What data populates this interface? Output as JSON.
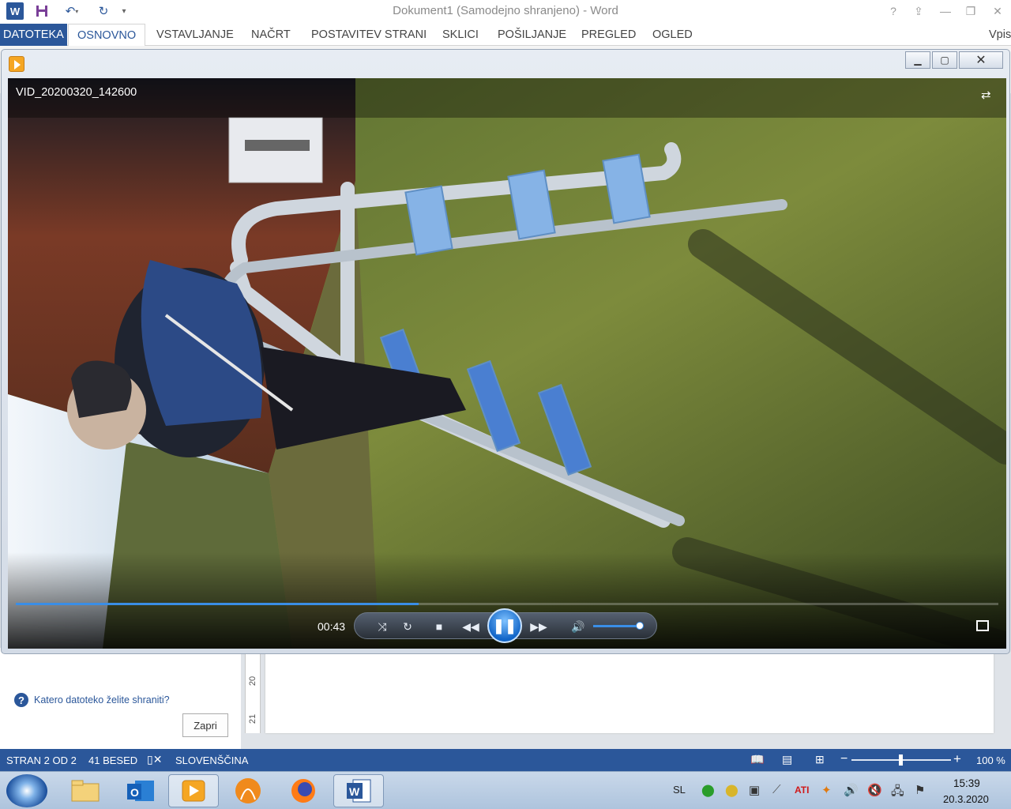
{
  "word": {
    "title": "Dokument1 (Samodejno shranjeno) - Word",
    "app_icon": "W",
    "window_controls": [
      "?",
      "⇪",
      "—",
      "❐",
      "✕"
    ],
    "tabs": [
      "DATOTEKA",
      "OSNOVNO",
      "VSTAVLJANJE",
      "NAČRT",
      "POSTAVITEV STRANI",
      "SKLICI",
      "POŠILJANJE",
      "PREGLED",
      "OGLED"
    ],
    "user_name": "Vpis",
    "active_tab": "OSNOVNO"
  },
  "player": {
    "video_title": "VID_20200320_142600",
    "time": "00:43",
    "progress": 0.41,
    "volume": 0.85,
    "icons": [
      "switch-view-icon",
      "fullscreen-icon",
      "shuffle-icon",
      "repeat-icon",
      "stop-icon",
      "previous-icon",
      "pause-icon",
      "next-icon",
      "volume-icon"
    ]
  },
  "side_pane": {
    "question": "Katero datoteko želite shraniti?",
    "close_label": "Zapri"
  },
  "ruler": {
    "n20": "20",
    "n21": "21"
  },
  "status": {
    "page": "STRAN 2 OD 2",
    "words": "41 BESED",
    "language": "SLOVENŠČINA",
    "zoom": "100 %",
    "zoom_minus": "−",
    "zoom_plus": "+"
  },
  "taskbar": {
    "lang": "SL",
    "time": "15:39",
    "date": "20.3.2020",
    "ati": "ATI"
  },
  "colors": {
    "word_blue": "#2b579a",
    "progress_blue": "#3a8ee6"
  }
}
